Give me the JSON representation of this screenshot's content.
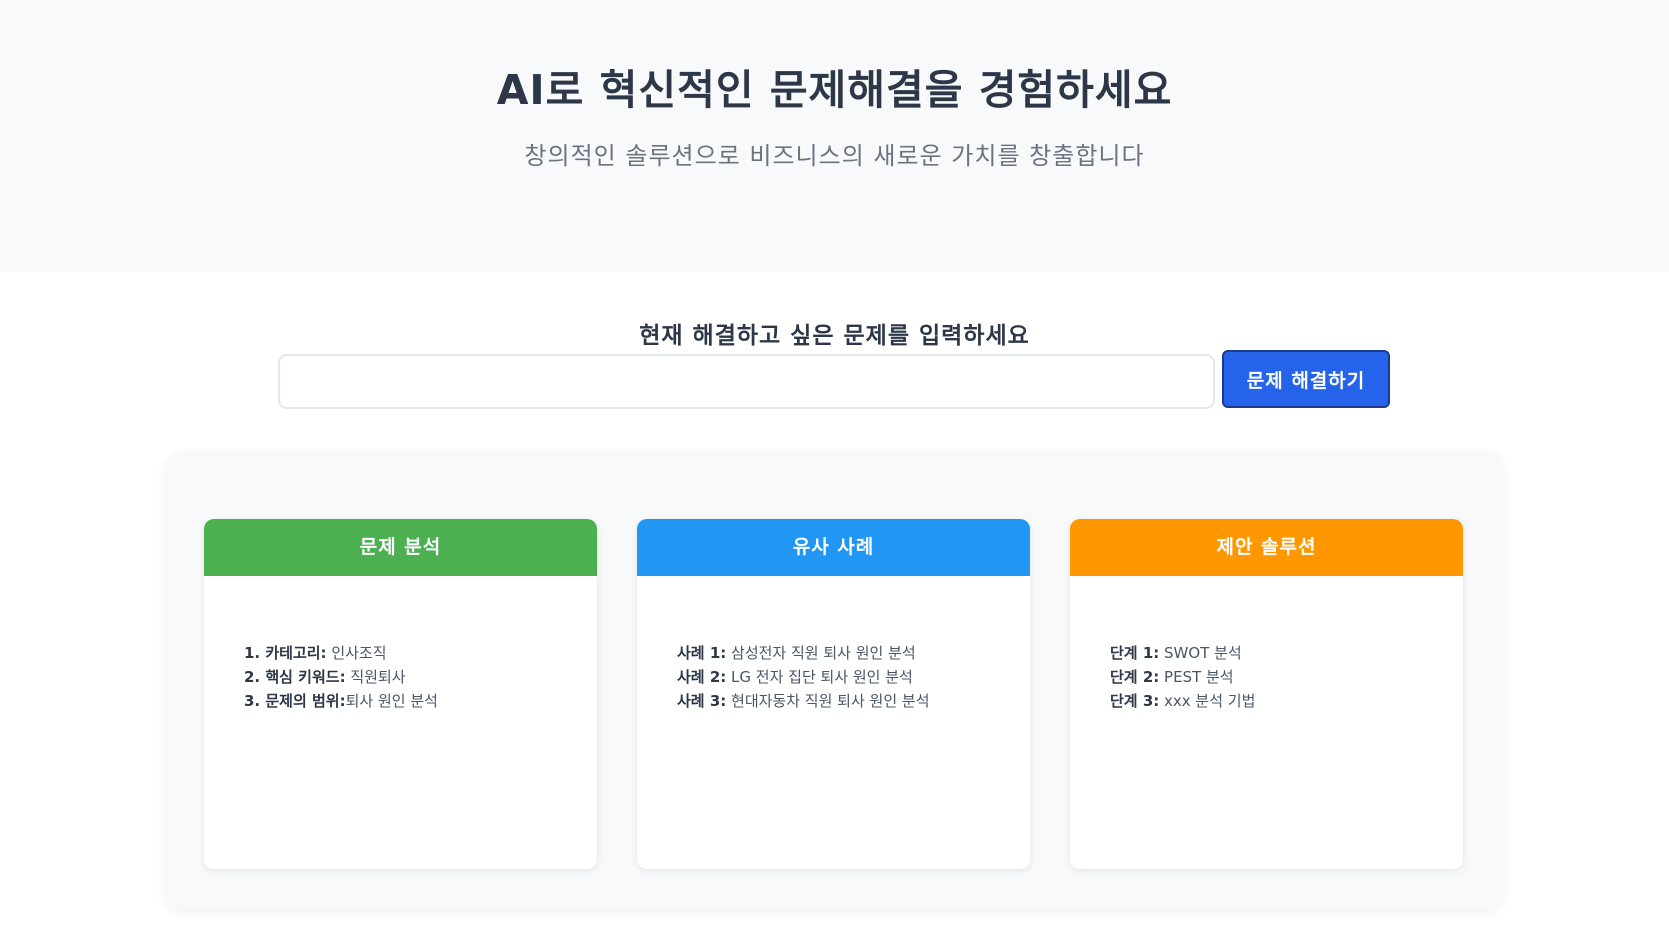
{
  "hero": {
    "title": "AI로 혁신적인 문제해결을 경험하세요",
    "subtitle": "창의적인 솔루션으로 비즈니스의 새로운 가치를 창출합니다"
  },
  "problem_form": {
    "label": "현재 해결하고 싶은 문제를 입력하세요",
    "input_value": "",
    "submit_label": "문제 해결하기"
  },
  "cards": [
    {
      "title": "문제 분석",
      "color": "#4caf50",
      "items": [
        {
          "key": "1. 카테고리:",
          "value": " 인사조직"
        },
        {
          "key": "2. 핵심 키워드:",
          "value": " 직원퇴사"
        },
        {
          "key": "3. 문제의 범위:",
          "value": "퇴사 원인 분석"
        }
      ]
    },
    {
      "title": "유사 사례",
      "color": "#2196f3",
      "items": [
        {
          "key": "사례 1:",
          "value": " 삼성전자 직원 퇴사 원인 분석"
        },
        {
          "key": "사례 2:",
          "value": " LG 전자 집단 퇴사 원인 분석"
        },
        {
          "key": "사례 3:",
          "value": " 현대자동차 직원 퇴사 원인 분석"
        }
      ]
    },
    {
      "title": "제안 솔루션",
      "color": "#ff9800",
      "items": [
        {
          "key": "단계 1:",
          "value": " SWOT 분석"
        },
        {
          "key": "단계 2:",
          "value": " PEST 분석"
        },
        {
          "key": "단계 3:",
          "value": " xxx 분석 기법"
        }
      ]
    }
  ]
}
